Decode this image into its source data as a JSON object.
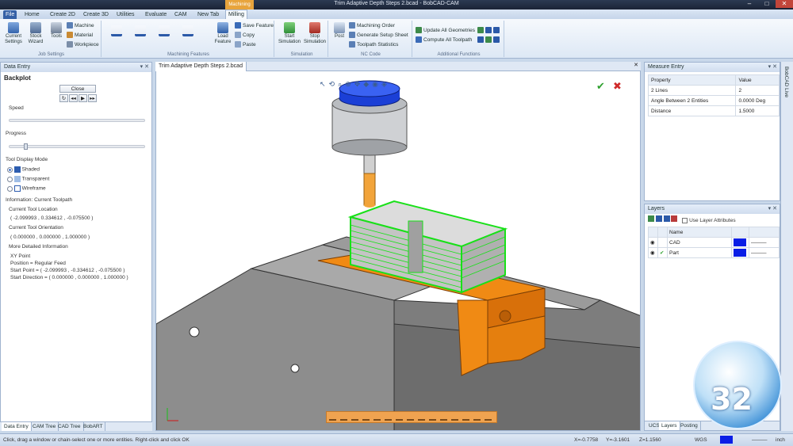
{
  "title": "Trim Adaptive Depth Steps 2.bcad - BobCAD-CAM",
  "context_group": "Machining",
  "menu": [
    "File",
    "Home",
    "Create 2D",
    "Create 3D",
    "Utilities",
    "Evaluate",
    "CAM",
    "New Tab",
    "Milling"
  ],
  "ribbon": {
    "job_settings": {
      "label": "Job Settings",
      "current_settings": "Current Settings",
      "stock_wizard": "Stock Wizard",
      "tools": "Tools",
      "machine": "Machine",
      "material": "Material",
      "workpiece": "Workpiece"
    },
    "machining_features": {
      "label": "Machining Features",
      "load_feature": "Load Feature",
      "save_feature": "Save Feature",
      "copy": "Copy",
      "paste": "Paste"
    },
    "simulation": {
      "label": "Simulation",
      "start": "Start Simulation",
      "stop": "Stop Simulation"
    },
    "nc_code": {
      "label": "NC Code",
      "post": "Post",
      "machining_order": "Machining Order",
      "generate_setup_sheet": "Generate Setup Sheet",
      "toolpath_statistics": "Toolpath Statistics"
    },
    "additional": {
      "label": "Additional Functions",
      "update_all": "Update All Geometries",
      "compute_all": "Compute All Toolpath"
    }
  },
  "data_entry": {
    "header": "Data Entry",
    "title": "Backplot",
    "close": "Close",
    "speed": "Speed",
    "progress": "Progress",
    "tool_display_mode": "Tool Display Mode",
    "modes": [
      "Shaded",
      "Transparent",
      "Wireframe"
    ],
    "info_legend": "Information: Current Toolpath",
    "current_tool_location": "Current Tool Location",
    "tool_location_value": "( -2.099993 , 0.334612 , -0.075500 )",
    "current_tool_orientation": "Current Tool Orientation",
    "tool_orientation_value": "( 0.000000 , 0.000000 , 1.000000 )",
    "more_detailed": "More Detailed Information",
    "details": [
      "XY Point",
      "Position = Regular Feed",
      "Start Point = ( -2.099993 , -0.334612 , -0.075500 )",
      "Start Direction = ( 0.000000 , 0.000000 , 1.000000 )"
    ]
  },
  "bottom_tabs": [
    "Data Entry",
    "CAM Tree",
    "CAD Tree",
    "BobART"
  ],
  "document_tab": "Trim Adaptive Depth Steps 2.bcad",
  "measure": {
    "header": "Measure Entry",
    "columns": [
      "Property",
      "Value"
    ],
    "rows": [
      [
        "2 Lines",
        "2"
      ],
      [
        "Angle Between 2 Entities",
        "0.0000 Deg"
      ],
      [
        "Distance",
        "1.5000"
      ]
    ]
  },
  "layers": {
    "header": "Layers",
    "use_layer_attributes": "Use Layer Attributes",
    "column": "Name",
    "rows": [
      "CAD",
      "Part"
    ]
  },
  "layer_tabs": [
    "UCS",
    "Layers",
    "Posting"
  ],
  "right_strip": "BobCAD Live",
  "badge": "32",
  "status": {
    "message": "Click, drag a window or chain-select one or more entities. Right-click and click OK",
    "x": "X=-0.7758",
    "y": "Y=-3.1601",
    "z": "Z=1.1560",
    "units": "WGS",
    "suffix": "inch"
  },
  "colors": {
    "accent": "#e8a43c",
    "file_tab": "#3560a6",
    "toolpath": "#19e019",
    "vise": "#f08a14",
    "tool_tip": "#f2a43a",
    "tool_cap": "#1b3fd6"
  }
}
